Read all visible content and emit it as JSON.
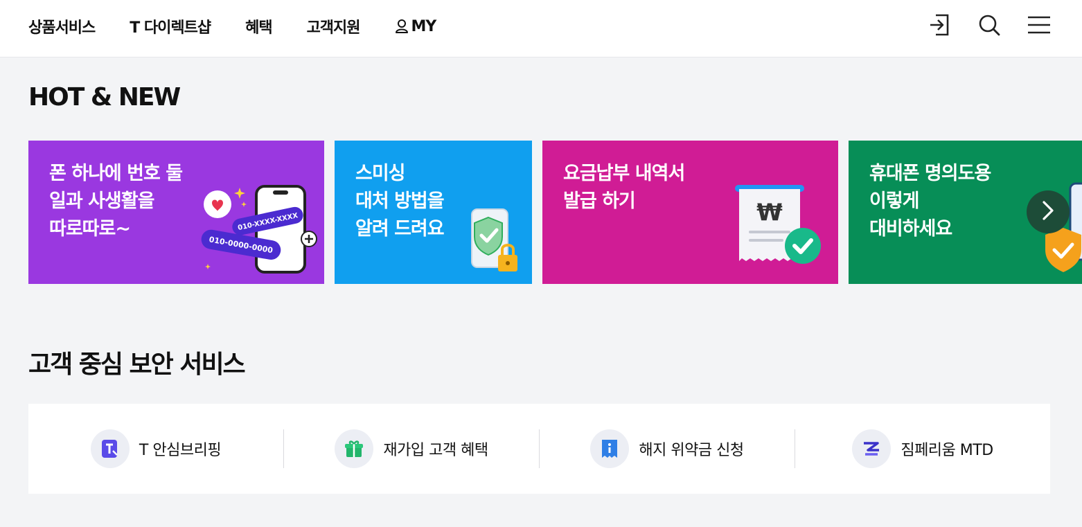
{
  "header": {
    "nav": [
      "상품서비스",
      "T 다이렉트샵",
      "혜택",
      "고객지원"
    ],
    "my_label": "MY",
    "icons": [
      "login-icon",
      "search-icon",
      "menu-icon"
    ]
  },
  "hot_new": {
    "title": "HOT & NEW",
    "banners": [
      {
        "lines": [
          "폰 하나에 번호 둘",
          "일과 사생활을",
          "따로따로~"
        ],
        "art_texts": [
          "010-XXXX-XXXX",
          "010-0000-0000"
        ],
        "color": "#9a38e0"
      },
      {
        "lines": [
          "스미싱",
          "대처 방법을",
          "알려 드려요"
        ],
        "color": "#109fef"
      },
      {
        "lines": [
          "요금납부 내역서",
          "발급 하기"
        ],
        "color": "#d01c95"
      },
      {
        "lines": [
          "휴대폰 명의도용",
          "이렇게",
          "대비하세요"
        ],
        "color": "#078e57"
      }
    ]
  },
  "security": {
    "title": "고객 중심 보안 서비스",
    "items": [
      {
        "label": "T 안심브리핑",
        "icon": "t-briefing-icon"
      },
      {
        "label": "재가입 고객 혜택",
        "icon": "gift-icon"
      },
      {
        "label": "해지 위약금 신청",
        "icon": "info-receipt-icon"
      },
      {
        "label": "짐페리움 MTD",
        "icon": "zimperium-logo-icon"
      }
    ]
  }
}
